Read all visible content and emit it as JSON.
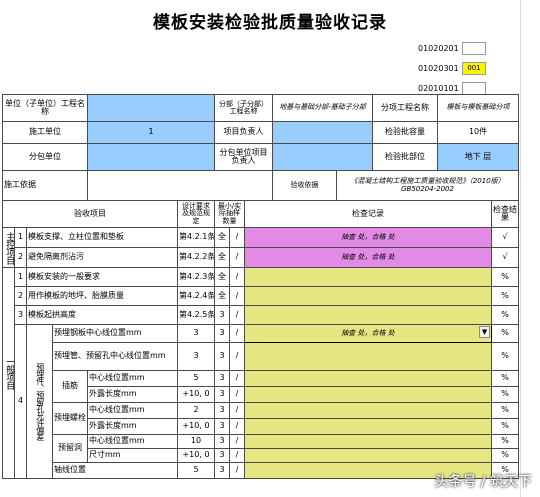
{
  "title": "模板安装检验批质量验收记录",
  "codes": [
    {
      "label": "01020201",
      "value": "",
      "highlight": false
    },
    {
      "label": "01020301",
      "value": "001",
      "highlight": true
    },
    {
      "label": "02010101",
      "value": "",
      "highlight": false
    }
  ],
  "header": {
    "unit_name_label": "单位（子单位）工程名称",
    "sub_project_label": "分部（子分部）工程名称",
    "sub_project_value": "地基与基础分部-基础子分部",
    "item_project_label": "分项工程名称",
    "item_project_value": "模板与模板基础分项",
    "contractor_label": "施工单位",
    "contractor_value": "1",
    "project_lead_label": "项目负责人",
    "capacity_label": "检验批容量",
    "capacity_value": "10件",
    "subcontractor_label": "分包单位",
    "sub_lead_label": "分包单位项目负责人",
    "location_label": "检验批部位",
    "location_value": "地下 层",
    "basis_label": "施工依据",
    "accept_basis_label": "验收依据",
    "accept_basis_value": "《混凝土结构工程施工质量验收规范》（2010版）GB50204-2002"
  },
  "columns": {
    "item": "验收项目",
    "spec": "设计要求及规范规定",
    "sample": "最小/实际抽样数量",
    "record": "检查记录",
    "result": "检查结果"
  },
  "main_control": {
    "label": "主控项目",
    "rows": [
      {
        "no": "1",
        "name": "模板支撑、立柱位置和垫板",
        "spec": "第4.2.1条",
        "min": "全",
        "actual": "/",
        "record": "抽查 处，合格 处",
        "result": "√"
      },
      {
        "no": "2",
        "name": "避免隔离剂沾污",
        "spec": "第4.2.2条",
        "min": "全",
        "actual": "/",
        "record": "抽查 处，合格 处",
        "result": "√"
      }
    ]
  },
  "general": {
    "label": "一般项目",
    "rows": [
      {
        "no": "1",
        "name": "模板安装的一般要求",
        "spec": "第4.2.3条",
        "min": "全",
        "actual": "/",
        "record": "",
        "result": "%"
      },
      {
        "no": "2",
        "name": "用作模板的地坪、胎膜质量",
        "spec": "第4.2.4条",
        "min": "全",
        "actual": "/",
        "record": "",
        "result": "%"
      },
      {
        "no": "3",
        "name": "模板起拱高度",
        "spec": "第4.2.5条",
        "min": "3",
        "actual": "/",
        "record": "",
        "result": "%"
      }
    ],
    "embed_no": "4",
    "embed_label": "预埋件、预留孔允许偏差",
    "embed_rows": [
      {
        "name": "预埋钢板中心线位置mm",
        "spec": "3",
        "min": "3",
        "actual": "/",
        "record": "抽查 处，合格 处",
        "result": "%"
      },
      {
        "name": "预埋管、预留孔中心线位置mm",
        "spec": "3",
        "min": "3",
        "actual": "/",
        "record": "",
        "result": "%"
      }
    ],
    "sub_groups": [
      {
        "label": "插筋",
        "rows": [
          {
            "name": "中心线位置mm",
            "spec": "5",
            "min": "3",
            "actual": "/",
            "record": "",
            "result": "%"
          },
          {
            "name": "外露长度mm",
            "spec": "+10, 0",
            "min": "3",
            "actual": "/",
            "record": "",
            "result": "%"
          }
        ]
      },
      {
        "label": "预埋螺栓",
        "rows": [
          {
            "name": "中心线位置mm",
            "spec": "2",
            "min": "3",
            "actual": "/",
            "record": "",
            "result": "%"
          },
          {
            "name": "外露长度mm",
            "spec": "+10, 0",
            "min": "3",
            "actual": "/",
            "record": "",
            "result": "%"
          }
        ]
      },
      {
        "label": "预留洞",
        "rows": [
          {
            "name": "中心线位置mm",
            "spec": "10",
            "min": "3",
            "actual": "/",
            "record": "",
            "result": "%"
          },
          {
            "name": "尺寸mm",
            "spec": "+10, 0",
            "min": "3",
            "actual": "/",
            "record": "",
            "result": "%"
          }
        ]
      }
    ],
    "last_row": {
      "name": "轴线位置",
      "spec": "5",
      "min": "3",
      "actual": "/",
      "record": "",
      "result": "%"
    }
  },
  "watermark": "头条号 / 筑天下",
  "colors": {
    "blue": "#99ccff",
    "magenta": "#e38ae6",
    "yellow": "#e6e683",
    "code_highlight": "#fff200"
  }
}
